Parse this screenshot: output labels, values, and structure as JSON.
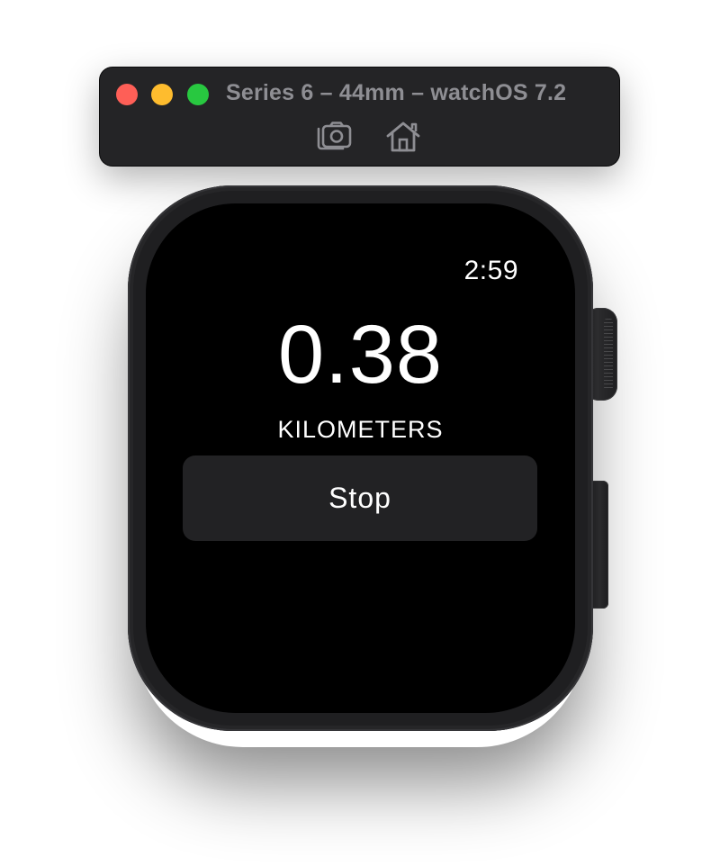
{
  "window": {
    "title": "Series 6 – 44mm – watchOS 7.2",
    "toolbar": {
      "screenshot_icon": "camera-screenshot-icon",
      "home_icon": "home-icon"
    },
    "traffic_lights": {
      "close_color": "#fe5f57",
      "minimize_color": "#febc2e",
      "zoom_color": "#28c840"
    }
  },
  "watch": {
    "status_time": "2:59",
    "distance_value": "0.38",
    "distance_unit": "KILOMETERS",
    "stop_label": "Stop"
  },
  "colors": {
    "titlebar_bg": "#242426",
    "title_text": "#8e8e93",
    "screen_bg": "#000000",
    "button_bg": "#222224",
    "text": "#ffffff"
  }
}
